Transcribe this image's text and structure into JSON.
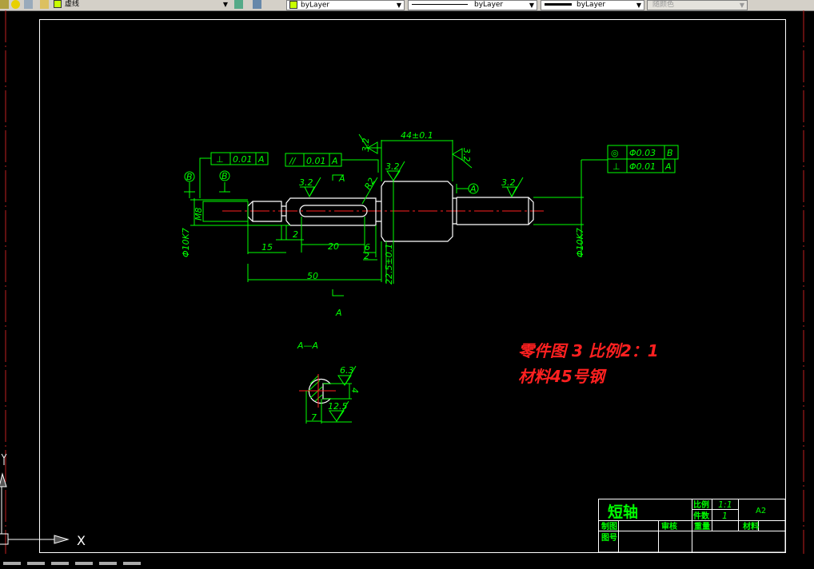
{
  "toolbar": {
    "layer_name": "虚线",
    "color": "byLayer",
    "linetype": "byLayer",
    "lineweight": "byLayer",
    "plot_style": "随颜色",
    "color_swatch": "#c8ff00"
  },
  "drawing": {
    "dims": {
      "d44": "44±0.1",
      "d15": "15",
      "d2a": "2",
      "d20": "20",
      "d6": "6",
      "d2b": "2",
      "d50": "50",
      "d22": "22.5±0.1",
      "m8": "M8",
      "phi_left": "Φ10K7",
      "phi_right": "Φ10K7",
      "r2": "R2"
    },
    "roughness": {
      "r1": "3.2",
      "r2": "3.2",
      "r3": "3.2",
      "r4": "3.2",
      "r5": "3.2",
      "r6": "3.2"
    },
    "tolerance_frames": {
      "left_perp": {
        "symbol": "⊥",
        "value": "0.01",
        "datum": "A"
      },
      "parallel": {
        "symbol": "//",
        "value": "0.01",
        "datum": "A"
      },
      "right_concentric": {
        "symbol": "◎",
        "value": "Φ0.03",
        "datum": "B"
      },
      "right_perp": {
        "symbol": "⊥",
        "value": "Φ0.01",
        "datum": "A"
      }
    },
    "datums": {
      "b1": "B",
      "b2": "B",
      "a": "A"
    },
    "section_marks": {
      "top": "A",
      "bottom": "A"
    },
    "section_view": {
      "title": "A—A",
      "rough1": "6.3",
      "rough2": "12.5",
      "depth": "4",
      "width": "7"
    },
    "notes": {
      "line1": "零件图  3  比例2：1",
      "line2": "材料45号钢"
    },
    "ucs": {
      "x": "X",
      "y": "Y"
    }
  },
  "title_block": {
    "part_name": "短轴",
    "scale_label": "比例",
    "scale_value": "1:1",
    "count_label": "件数",
    "count_value": "1",
    "sheet": "A2",
    "drawn_label": "制图",
    "review_label": "审核",
    "weight_label": "重量",
    "material_label": "材料",
    "drawing_no_label": "图号"
  }
}
